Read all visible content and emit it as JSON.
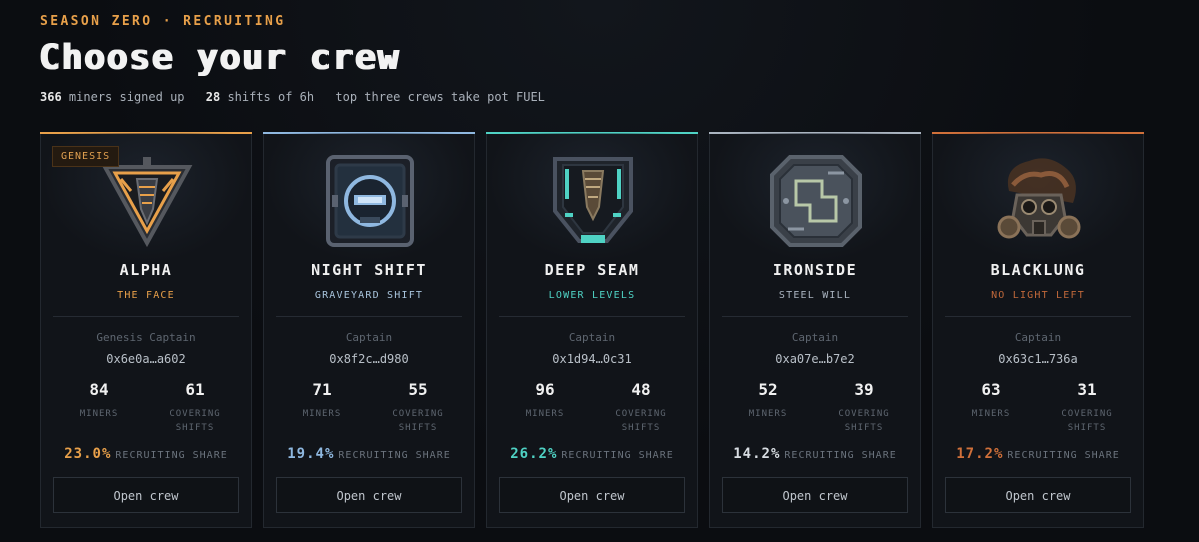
{
  "header": {
    "eyebrow": "SEASON ZERO · RECRUITING",
    "title": "Choose your crew",
    "stats": {
      "miners_count": "366",
      "miners_text": "miners signed up",
      "shifts_count": "28",
      "shifts_text": "shifts of 6h",
      "pot_text": "top three crews take pot FUEL"
    }
  },
  "labels": {
    "miners": "MINERS",
    "covering": "COVERING",
    "shifts": "SHIFTS",
    "recruiting_share": "RECRUITING SHARE",
    "open_button": "Open crew"
  },
  "crews": [
    {
      "name": "ALPHA",
      "tagline": "THE FACE",
      "badge": "GENESIS",
      "captain_label": "Genesis Captain",
      "captain_address": "0x6e0a…a602",
      "miners": "84",
      "covering_shifts": "61",
      "share": "23.0%",
      "accent": "#e8a04a",
      "emblem": "triangle-drill-icon"
    },
    {
      "name": "NIGHT SHIFT",
      "tagline": "GRAVEYARD SHIFT",
      "badge": "",
      "captain_label": "Captain",
      "captain_address": "0x8f2c…d980",
      "miners": "71",
      "covering_shifts": "55",
      "share": "19.4%",
      "accent": "#8fb8e0",
      "emblem": "helmet-box-icon"
    },
    {
      "name": "DEEP SEAM",
      "tagline": "LOWER LEVELS",
      "badge": "",
      "captain_label": "Captain",
      "captain_address": "0x1d94…0c31",
      "miners": "96",
      "covering_shifts": "48",
      "share": "26.2%",
      "accent": "#4fd2c4",
      "emblem": "drill-shield-icon"
    },
    {
      "name": "IRONSIDE",
      "tagline": "STEEL WILL",
      "badge": "",
      "captain_label": "Captain",
      "captain_address": "0xa07e…b7e2",
      "miners": "52",
      "covering_shifts": "39",
      "share": "14.2%",
      "accent": "#aab4c0",
      "emblem": "steel-plate-icon"
    },
    {
      "name": "BLACKLUNG",
      "tagline": "NO LIGHT LEFT",
      "badge": "",
      "captain_label": "Captain",
      "captain_address": "0x63c1…736a",
      "miners": "63",
      "covering_shifts": "31",
      "share": "17.2%",
      "accent": "#d0703a",
      "emblem": "gas-mask-icon"
    }
  ]
}
